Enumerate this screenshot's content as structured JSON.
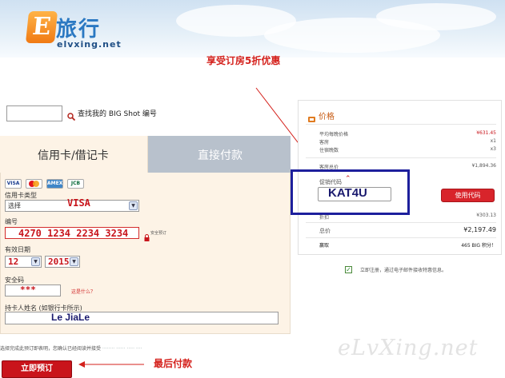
{
  "logo": {
    "glyph": "E",
    "cn": "旅行",
    "en": "elvxing.net"
  },
  "annotations": {
    "discount": "享受订房5折优惠",
    "final_pay": "最后付款"
  },
  "search_link": "查找我的 BIG Shot 编号",
  "tabs": {
    "credit": "信用卡/借记卡",
    "direct": "直接付款"
  },
  "card_logos": [
    "VISA",
    "MC",
    "AMEX",
    "JCB"
  ],
  "form": {
    "card_type_label": "信用卡类型",
    "card_type_value": "选择",
    "card_type_handwritten": "VISA",
    "number_label": "编号",
    "number_value": "4270 1234 2234 3234",
    "secure_pay": "安全预订",
    "expiry_label": "有效日期",
    "expiry_month": "12",
    "expiry_year": "2015",
    "cvv_label": "安全码",
    "cvv_value": "***",
    "cvv_help": "这是什么？",
    "holder_label": "持卡人姓名 (如银行卡所示)",
    "holder_value": "Le JiaLe"
  },
  "terms_text": "选择完成此预订即表明，您确认已经阅读并接受",
  "price": {
    "title": "价格",
    "rows": [
      {
        "label": "平均每晚价格",
        "value": "¥631.45",
        "red": true
      },
      {
        "label": "客房",
        "value": "x1",
        "red": false
      },
      {
        "label": "住宿晚数",
        "value": "x3",
        "red": false
      }
    ],
    "room_total_label": "客房总价",
    "room_total_value": "¥1,894.36",
    "promo_label": "促销代码",
    "promo_value": "KAT4U",
    "apply_button": "使用代码",
    "discount_label": "折扣",
    "discount_value": "¥303.13",
    "total_label": "总价",
    "total_value": "¥2,197.49",
    "reward_label": "赢取",
    "reward_value": "465 BIG 积分！"
  },
  "newsletter": "立即注册，通过电子邮件接收特惠信息。",
  "submit_button": "立即预订",
  "watermark": "eLvXing.net",
  "colors": {
    "accent_red": "#d8242b",
    "box_blue": "#1d1f9c",
    "form_bg": "#fdf3e6",
    "tab_inactive": "#b8c1cc"
  }
}
